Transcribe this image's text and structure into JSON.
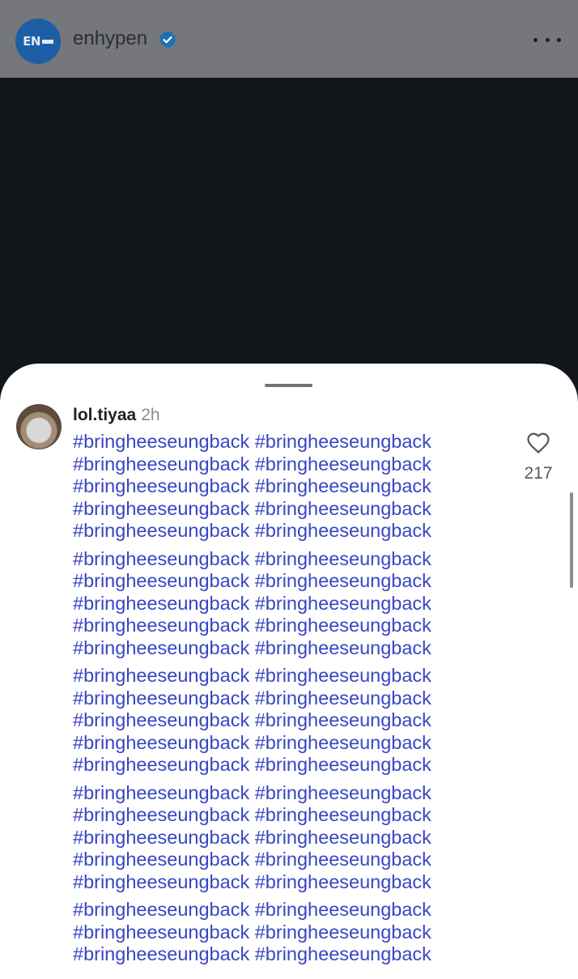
{
  "post": {
    "account": "enhypen",
    "avatar_text": "EN",
    "verified_icon": "verified-badge-icon",
    "more_icon": "more-options-icon"
  },
  "comment": {
    "username": "lol.tiyaa",
    "time": "2h",
    "likes": "217",
    "hashtag_line": "#bringheeseungback #bringheeseungback",
    "paragraphs": [
      [
        "#bringheeseungback #bringheeseungback",
        "#bringheeseungback #bringheeseungback",
        "#bringheeseungback #bringheeseungback",
        "#bringheeseungback #bringheeseungback",
        "#bringheeseungback #bringheeseungback"
      ],
      [
        "#bringheeseungback #bringheeseungback",
        "#bringheeseungback #bringheeseungback",
        "#bringheeseungback #bringheeseungback",
        "#bringheeseungback #bringheeseungback",
        "#bringheeseungback #bringheeseungback"
      ],
      [
        "#bringheeseungback #bringheeseungback",
        "#bringheeseungback #bringheeseungback",
        "#bringheeseungback #bringheeseungback",
        "#bringheeseungback #bringheeseungback",
        "#bringheeseungback #bringheeseungback"
      ],
      [
        "#bringheeseungback #bringheeseungback",
        "#bringheeseungback #bringheeseungback",
        "#bringheeseungback #bringheeseungback",
        "#bringheeseungback #bringheeseungback",
        "#bringheeseungback #bringheeseungback"
      ],
      [
        "#bringheeseungback #bringheeseungback",
        "#bringheeseungback #bringheeseungback",
        "#bringheeseungback #bringheeseungback"
      ]
    ]
  },
  "colors": {
    "hashtag": "#3845c4",
    "header_overlay": "#75777a",
    "verified": "#1f6fb5"
  }
}
